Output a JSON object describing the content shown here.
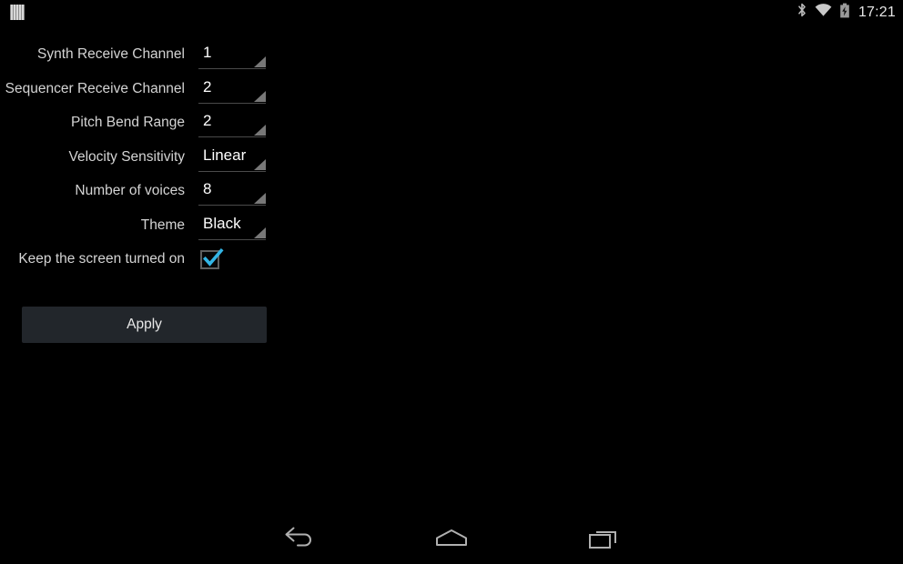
{
  "status_bar": {
    "app_icon": "piano-keys-icon",
    "icons": [
      "bluetooth-icon",
      "wifi-icon",
      "battery-charging-icon"
    ],
    "time": "17:21"
  },
  "settings": {
    "rows": [
      {
        "label": "Synth Receive Channel",
        "value": "1",
        "control": "spinner"
      },
      {
        "label": "Sequencer Receive Channel",
        "value": "2",
        "control": "spinner"
      },
      {
        "label": "Pitch Bend Range",
        "value": "2",
        "control": "spinner"
      },
      {
        "label": "Velocity Sensitivity",
        "value": "Linear",
        "control": "spinner"
      },
      {
        "label": "Number of voices",
        "value": "8",
        "control": "spinner"
      },
      {
        "label": "Theme",
        "value": "Black",
        "control": "spinner"
      }
    ],
    "checkbox_row": {
      "label": "Keep the screen turned on",
      "checked": true,
      "check_color": "#33b5e5"
    },
    "apply_label": "Apply"
  },
  "nav_bar": {
    "buttons": [
      {
        "name": "back-icon",
        "label": "Back"
      },
      {
        "name": "home-icon",
        "label": "Home"
      },
      {
        "name": "recents-icon",
        "label": "Recent apps"
      }
    ]
  },
  "colors": {
    "background": "#000000",
    "label_text": "#d4d4d4",
    "value_text": "#ffffff",
    "accent": "#33b5e5",
    "button_bg": "#22262b",
    "spinner_arrow": "#787878"
  }
}
